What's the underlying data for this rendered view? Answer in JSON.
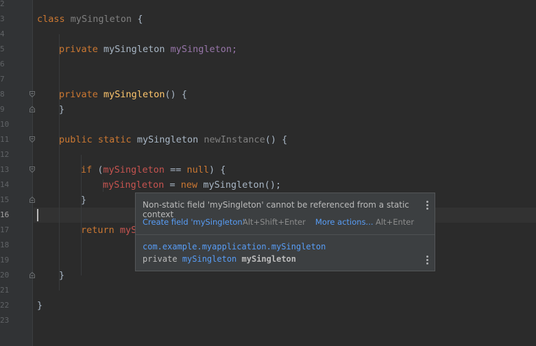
{
  "line_numbers": [
    "2",
    "3",
    "4",
    "5",
    "6",
    "7",
    "8",
    "9",
    "10",
    "11",
    "12",
    "13",
    "14",
    "15",
    "16",
    "17",
    "18",
    "19",
    "20",
    "21",
    "22",
    "23"
  ],
  "code": {
    "l3": [
      "class",
      "mySingleton",
      "{"
    ],
    "l5": [
      "private",
      "mySingleton",
      "mySingleton;"
    ],
    "l8": [
      "private",
      "mySingleton",
      "() {"
    ],
    "l9": [
      "}"
    ],
    "l11": [
      "public",
      "static",
      "mySingleton",
      "newInstance",
      "() {"
    ],
    "l13": [
      "if",
      "(",
      "mySingleton",
      " == ",
      "null",
      ") {"
    ],
    "l14": [
      "mySingleton",
      " = ",
      "new",
      " mySingleton();"
    ],
    "l15": [
      "}"
    ],
    "l17": [
      "return",
      "myS"
    ],
    "l20": [
      "}"
    ],
    "l22": [
      "}"
    ]
  },
  "popup": {
    "message": "Non-static field 'mySingleton' cannot be referenced from a static context",
    "action1": "Create field 'mySingleton'",
    "action1_shortcut": "Alt+Shift+Enter",
    "action2": "More actions...",
    "action2_shortcut": "Alt+Enter",
    "fq_name": "com.example.myapplication.mySingleton",
    "decl_modifier": "private",
    "decl_type": "mySingleton",
    "decl_name": "mySingleton"
  }
}
